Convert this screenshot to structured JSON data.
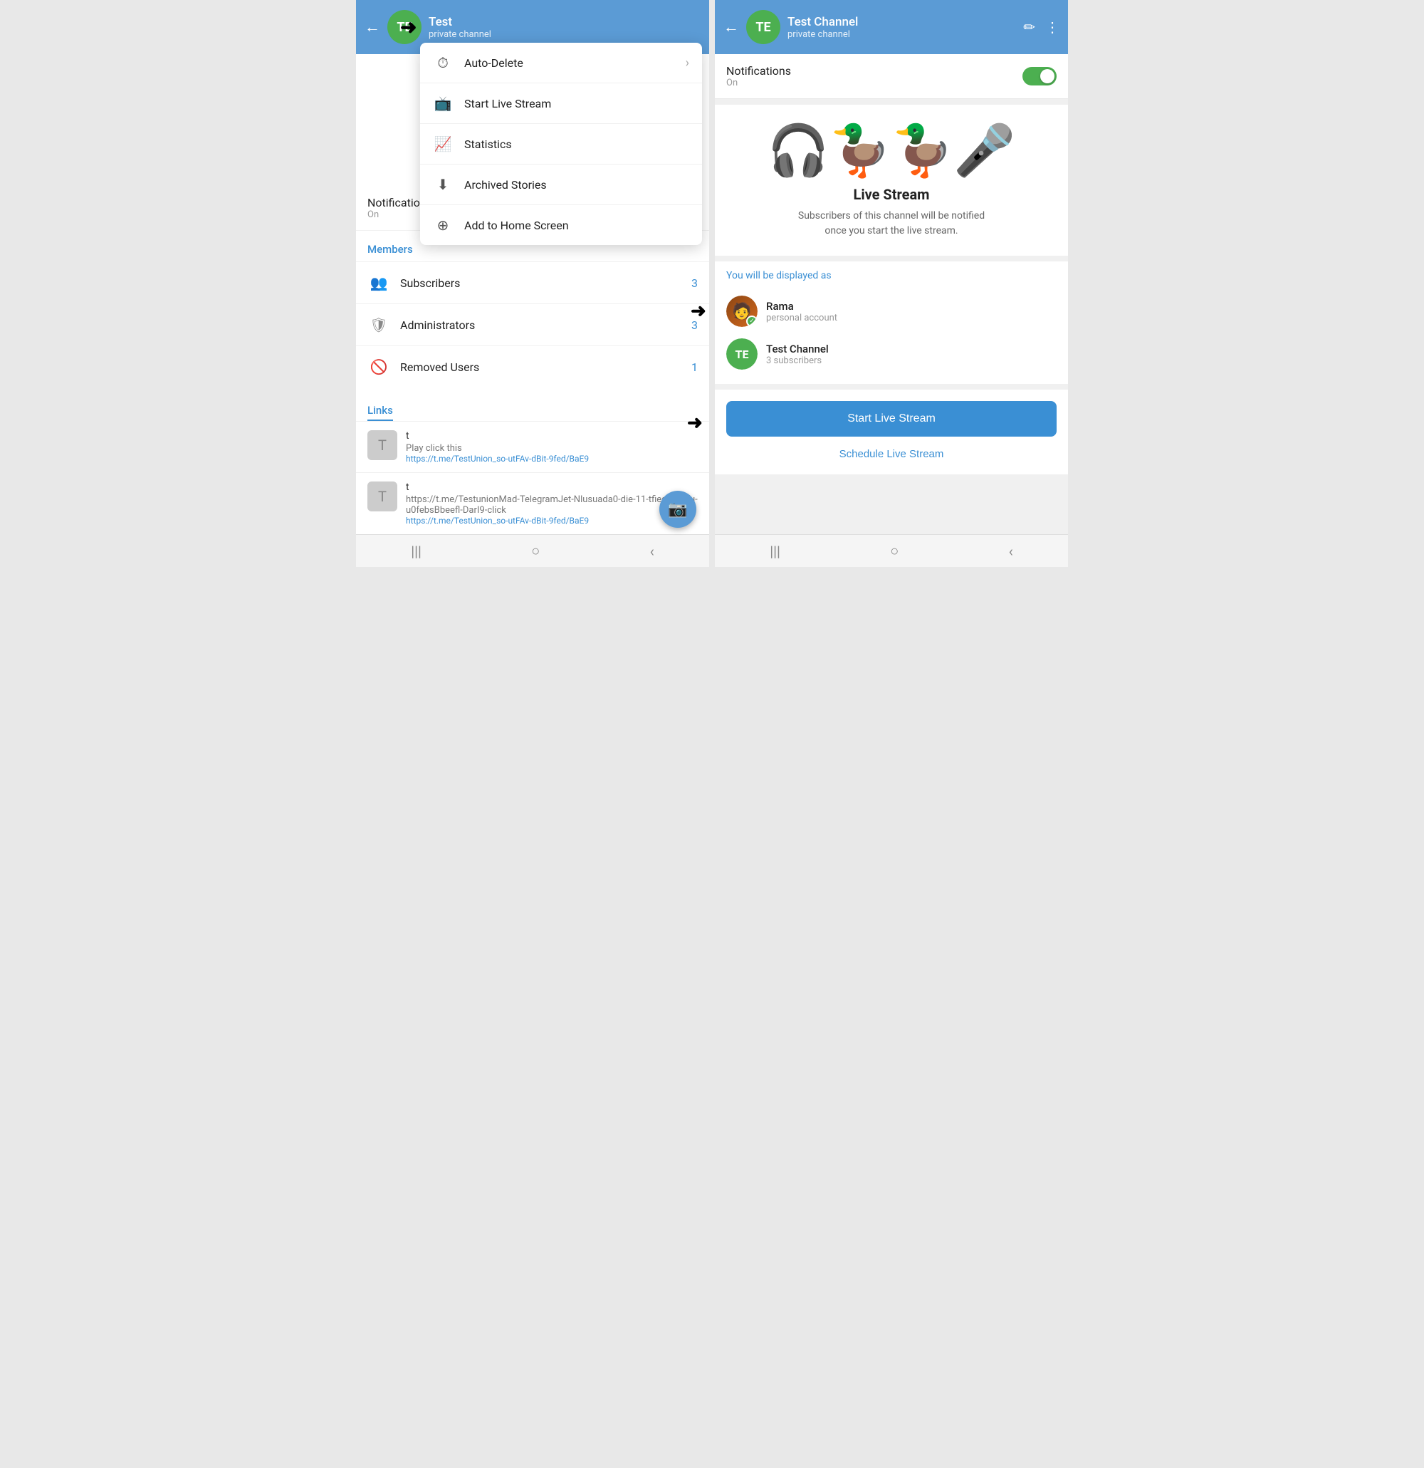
{
  "left": {
    "back_arrow": "←",
    "avatar_initials": "TE",
    "channel_name": "Test",
    "channel_type": "private channel",
    "arrow_symbol": "➜",
    "dropdown": {
      "items": [
        {
          "label": "Auto-Delete",
          "icon": "⏱",
          "has_chevron": true
        },
        {
          "label": "Start Live Stream",
          "icon": "📺",
          "has_chevron": false
        },
        {
          "label": "Statistics",
          "icon": "📈",
          "has_chevron": false
        },
        {
          "label": "Archived Stories",
          "icon": "⬇",
          "has_chevron": false
        },
        {
          "label": "Add to Home Screen",
          "icon": "⊕",
          "has_chevron": false
        }
      ]
    },
    "notifications": {
      "label": "Notifications",
      "sublabel": "On"
    },
    "members_section": "Members",
    "members": [
      {
        "label": "Subscribers",
        "count": "3"
      },
      {
        "label": "Administrators",
        "count": "3"
      },
      {
        "label": "Removed Users",
        "count": "1"
      }
    ],
    "links_section": "Links",
    "link_items": [
      {
        "title": "t",
        "desc": "Play click this",
        "url": "https://t.me/TestUnion_so-utFAv-dBit-9fed/BaE9"
      },
      {
        "title": "t",
        "desc": "https://t.me/TestunionMad-TelegramJet-Nlusuada0-die-11-tfies-ue8-fu-u0febsBbeefl-DarI9-click",
        "url": "https://t.me/TestUnion_so-utFAv-dBit-9fed/BaE9"
      }
    ],
    "fab_icon": "📷",
    "nav": [
      "|||",
      "○",
      "‹"
    ]
  },
  "right": {
    "back_arrow": "←",
    "avatar_initials": "TE",
    "channel_name": "Test Channel",
    "channel_type": "private channel",
    "edit_icon": "✏",
    "more_icon": "⋮",
    "notifications": {
      "label": "Notifications",
      "sublabel": "On"
    },
    "live_stream": {
      "title": "Live Stream",
      "description": "Subscribers of this channel will be notified once you start the live stream."
    },
    "display_as_title": "You will be displayed as",
    "display_accounts": [
      {
        "name": "Rama",
        "sublabel": "personal account",
        "type": "user"
      },
      {
        "name": "Test Channel",
        "sublabel": "3 subscribers",
        "type": "channel",
        "initials": "TE"
      }
    ],
    "start_btn": "Start Live Stream",
    "schedule_btn": "Schedule Live Stream",
    "arrow_symbol": "➜",
    "nav": [
      "|||",
      "○",
      "‹"
    ]
  }
}
